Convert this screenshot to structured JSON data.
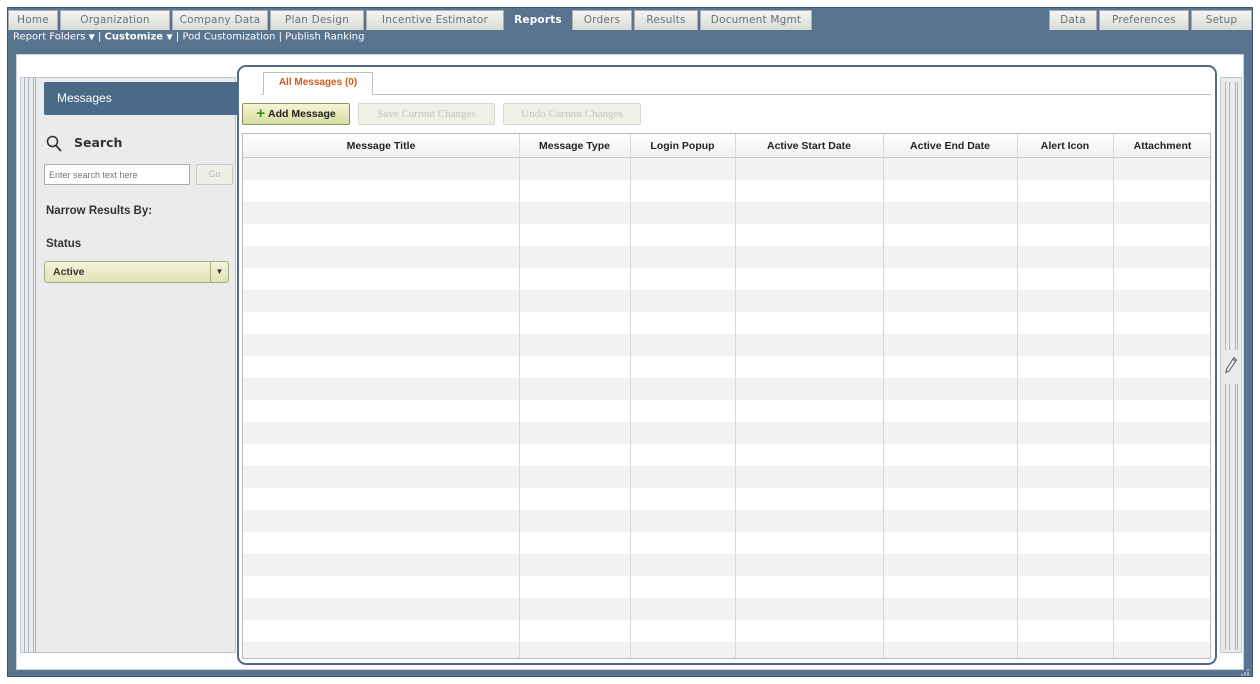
{
  "top_tabs": [
    {
      "label": "Home",
      "active": false
    },
    {
      "label": "Organization",
      "active": false
    },
    {
      "label": "Company Data",
      "active": false
    },
    {
      "label": "Plan Design",
      "active": false
    },
    {
      "label": "Incentive Estimator",
      "active": false
    },
    {
      "label": "Reports",
      "active": true
    },
    {
      "label": "Orders",
      "active": false
    },
    {
      "label": "Results",
      "active": false
    },
    {
      "label": "Document Mgmt",
      "active": false
    },
    {
      "label": "Data",
      "active": false
    },
    {
      "label": "Preferences",
      "active": false
    },
    {
      "label": "Setup",
      "active": false
    }
  ],
  "subnav": {
    "report_folders": "Report Folders",
    "customize": "Customize",
    "pod_customization": "Pod Customization",
    "publish_ranking": "Publish Ranking",
    "separator": "|"
  },
  "left_panel": {
    "header": "Messages",
    "search_title": "Search",
    "search_placeholder": "Enter search text here",
    "go_label": "Go",
    "narrow_label": "Narrow Results By:",
    "status_label": "Status",
    "status_value": "Active"
  },
  "main": {
    "tab_label": "All Messages (0)",
    "add_message_label": "Add Message",
    "save_changes_label": "Save Current Changes",
    "undo_changes_label": "Undo Current Changes",
    "columns": [
      "Message Title",
      "Message Type",
      "Login Popup",
      "Active Start Date",
      "Active End Date",
      "Alert Icon",
      "Attachment"
    ]
  },
  "colors": {
    "frame": "#59748f",
    "panel_border": "#4f6b87",
    "active_tab_text": "#d15b1d",
    "add_icon": "#3c8a1e"
  },
  "icons": [
    "search-icon",
    "pencil-icon",
    "plus-icon",
    "chevron-down-icon",
    "resize-grip-icon"
  ]
}
